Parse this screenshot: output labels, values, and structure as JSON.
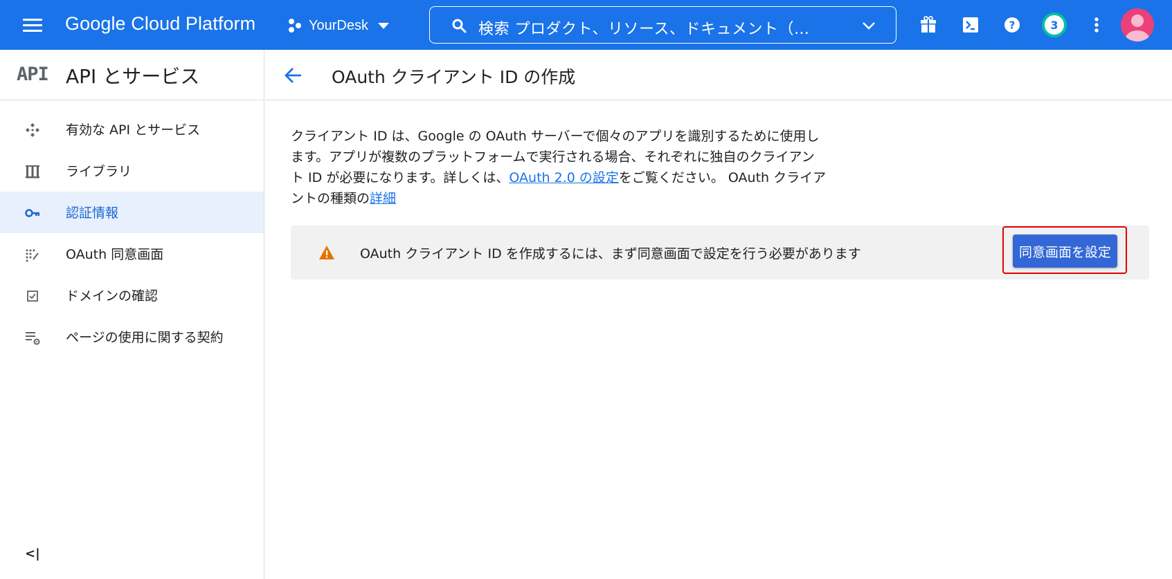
{
  "topbar": {
    "brand": "Google Cloud Platform",
    "project_name": "YourDesk",
    "search_text": "検索  プロダクト、リソース、ドキュメント（…",
    "notification_count": "3",
    "icons": [
      "menu-icon",
      "project-icon",
      "search-icon",
      "chevron-down-icon",
      "gift-icon",
      "cloud-shell-icon",
      "help-icon",
      "more-vert-icon",
      "avatar"
    ],
    "accent": "#1a73e8"
  },
  "sidebar": {
    "logo": "API",
    "title": "API とサービス",
    "items": [
      {
        "label": "有効な API とサービス",
        "icon": "diamond-dots-icon",
        "active": false
      },
      {
        "label": "ライブラリ",
        "icon": "library-icon",
        "active": false
      },
      {
        "label": "認証情報",
        "icon": "key-icon",
        "active": true
      },
      {
        "label": "OAuth 同意画面",
        "icon": "consent-dots-icon",
        "active": false
      },
      {
        "label": "ドメインの確認",
        "icon": "checkbox-icon",
        "active": false
      },
      {
        "label": "ページの使用に関する契約",
        "icon": "settings-list-icon",
        "active": false
      }
    ],
    "collapse_label": "<|"
  },
  "main": {
    "title": "OAuth クライアント ID の作成",
    "desc_part1": "クライアント ID は、Google の OAuth サーバーで個々のアプリを識別するために使用します。アプリが複数のプラットフォームで実行される場合、それぞれに独自のクライアント ID が必要になります。詳しくは、",
    "desc_link1": "OAuth 2.0 の設定",
    "desc_part2": "をご覧ください。 OAuth クライアントの種類の",
    "desc_link2": "詳細",
    "notice_text": "OAuth クライアント ID を作成するには、まず同意画面で設定を行う必要があります",
    "notice_button": "同意画面を設定"
  },
  "colors": {
    "warning": "#e37400",
    "active_bg": "#e8f0fe",
    "button": "#3367d6",
    "highlight": "#e00000"
  }
}
